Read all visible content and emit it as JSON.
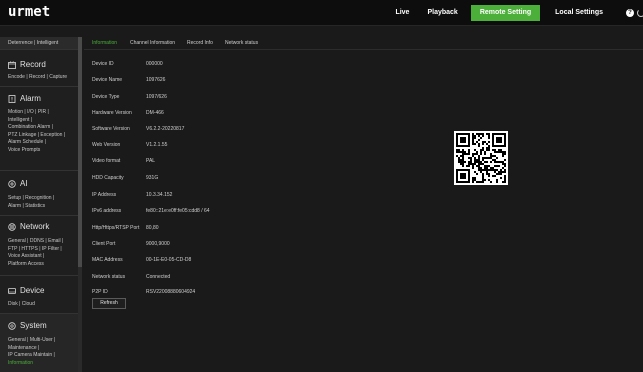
{
  "brand": {
    "logo": "urmet"
  },
  "topnav": {
    "items": [
      "Live",
      "Playback",
      "Remote Setting",
      "Local Settings"
    ],
    "active": "Remote Setting",
    "help_icon": "help-icon",
    "power_icon": "power-icon"
  },
  "sidebar": {
    "top_links": "Deterrence | Intelligent",
    "sections": [
      {
        "title": "Record",
        "icon": "record-icon",
        "links": [
          "Encode | Record | Capture"
        ]
      },
      {
        "title": "Alarm",
        "icon": "alarm-icon",
        "links": [
          "Motion | I/O | PIR |",
          "Intelligent |",
          "Combination Alarm |",
          "PTZ Linkage | Exception |",
          "Alarm Schedule |",
          "Voice Prompts"
        ]
      },
      {
        "title": "AI",
        "icon": "ai-icon",
        "links": [
          "Setup | Recognition |",
          "Alarm | Statistics"
        ]
      },
      {
        "title": "Network",
        "icon": "network-icon",
        "links": [
          "General | DDNS | Email |",
          "FTP | HTTPS | IP Filter |",
          "Voice Assistant |",
          "Platform Access"
        ]
      },
      {
        "title": "Device",
        "icon": "device-icon",
        "links": [
          "Disk | Cloud"
        ]
      },
      {
        "title": "System",
        "icon": "system-icon",
        "links": [
          "General | Multi-User |",
          "Maintenance |",
          "IP Camera Maintain |"
        ],
        "active_link": "Information"
      }
    ]
  },
  "tabs": [
    "Information",
    "Channel Information",
    "Record Info",
    "Network status"
  ],
  "active_tab": "Information",
  "info": [
    {
      "label": "Device ID",
      "value": "000000"
    },
    {
      "label": "Device Name",
      "value": "1097626"
    },
    {
      "label": "Device Type",
      "value": "1097/626"
    },
    {
      "label": "Hardware Version",
      "value": "DM-466"
    },
    {
      "label": "Software Version",
      "value": "V6.2.2-20220817"
    },
    {
      "label": "Web Version",
      "value": "V1.2.1.55"
    },
    {
      "label": "Video format",
      "value": "PAL"
    },
    {
      "label": "HDD Capacity",
      "value": "931G"
    },
    {
      "label": "IP Address",
      "value": "10.3.34.152"
    },
    {
      "label": "IPv6 address",
      "value": "fe80::21e:e0ff:fe05:cdd8 / 64"
    },
    {
      "label": "Http/Https/RTSP Port",
      "value": "80,80"
    },
    {
      "label": "Client Port",
      "value": "9000,9000"
    },
    {
      "label": "MAC Address",
      "value": "00-1E-E0-05-CD-D8"
    },
    {
      "label": "Network status",
      "value": "Connected"
    },
    {
      "label": "P2P ID",
      "value": "RSV22008880604924"
    }
  ],
  "refresh_label": "Refresh",
  "colors": {
    "accent": "#4caf3a",
    "bg": "#1a1a1a",
    "topbar": "#0d0d0d",
    "sidebar": "#1f1f1f"
  }
}
